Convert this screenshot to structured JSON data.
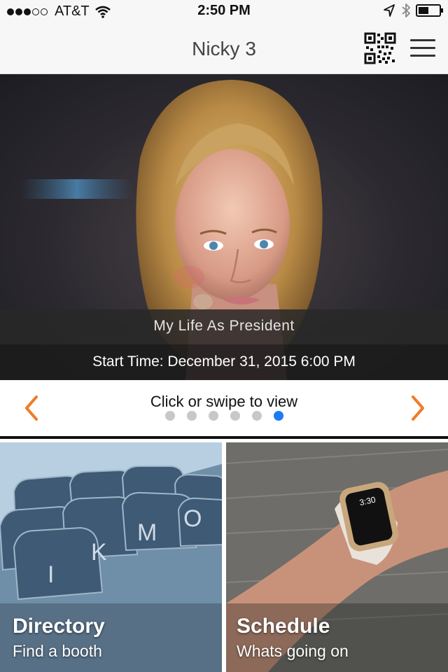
{
  "status_bar": {
    "carrier": "AT&T",
    "signal_bars": 3,
    "signal_total": 5,
    "time": "2:50 PM",
    "battery_level": 0.45
  },
  "header": {
    "title": "Nicky 3",
    "qr_icon": "qr-code-icon",
    "menu_icon": "hamburger-menu-icon"
  },
  "hero": {
    "title": "My Life As President",
    "start_time": "Start Time: December 31, 2015 6:00 PM"
  },
  "carousel": {
    "hint": "Click or swipe to view",
    "page_count": 6,
    "active_page": 6,
    "arrow_color": "#f07c2a",
    "active_dot_color": "#1a7cf5"
  },
  "tiles": [
    {
      "title": "Directory",
      "subtitle": "Find a booth"
    },
    {
      "title": "Schedule",
      "subtitle": "Whats going on"
    }
  ]
}
